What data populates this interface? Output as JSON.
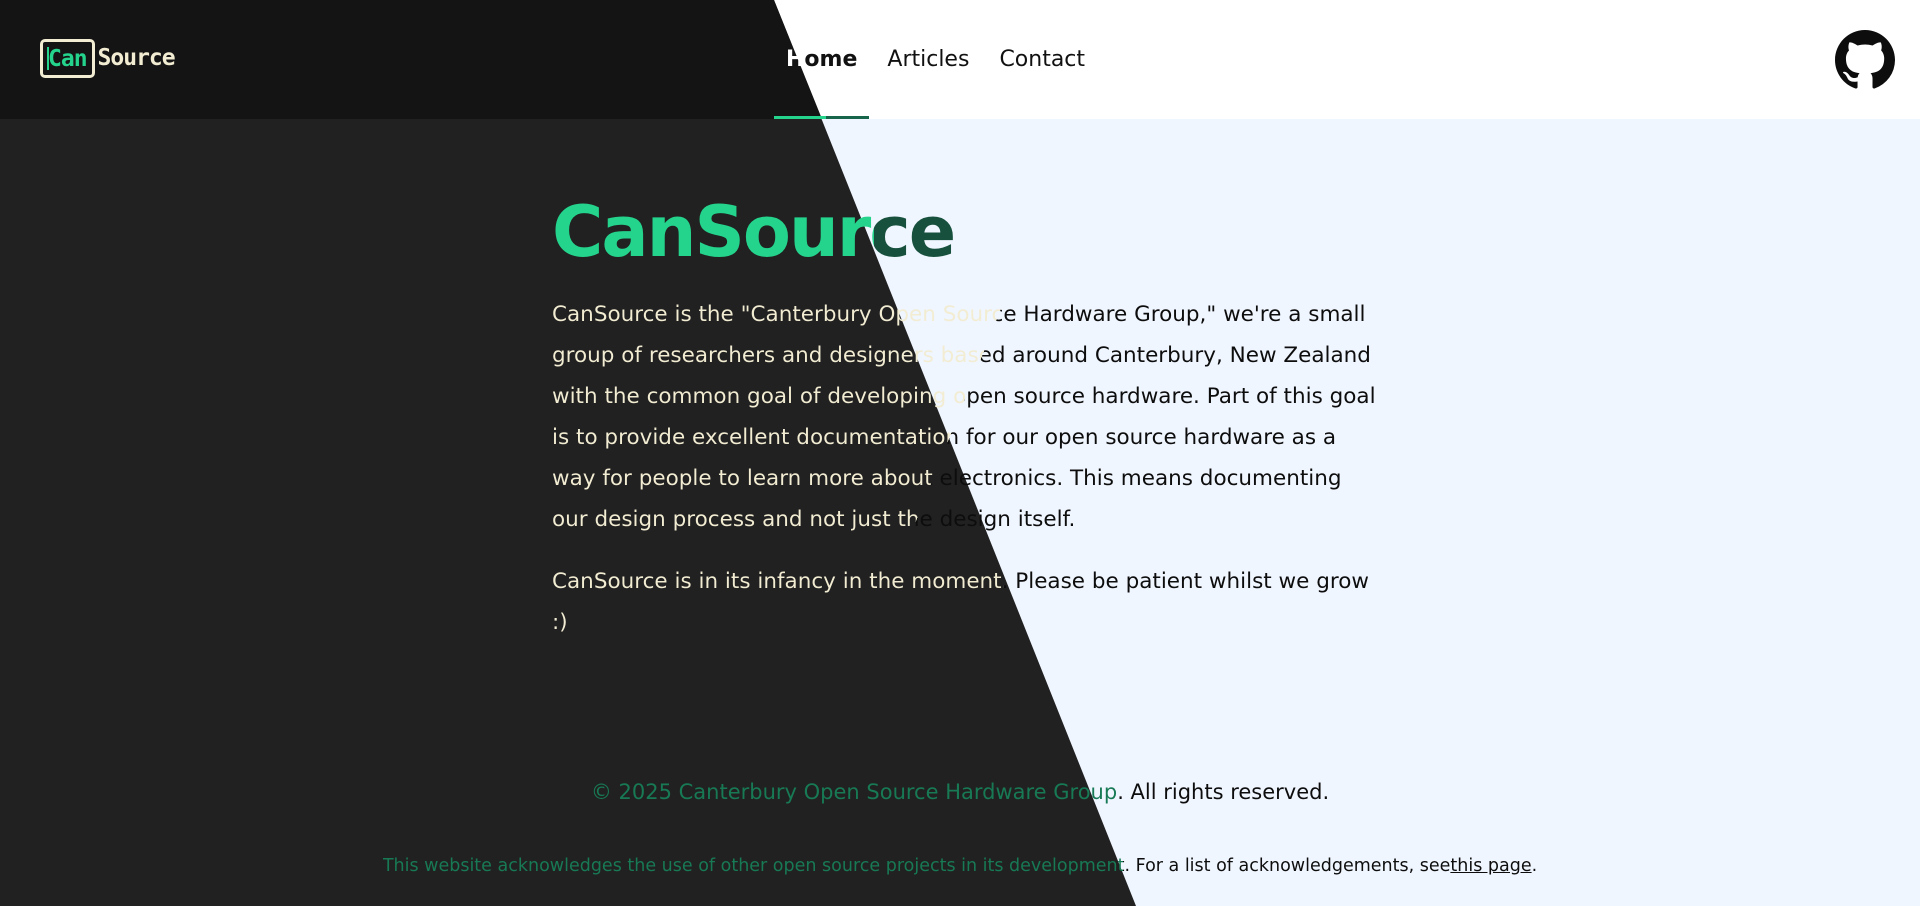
{
  "header": {
    "logo": {
      "box_text": "Can",
      "text": "Source"
    },
    "nav": [
      {
        "label": "Home",
        "active": true
      },
      {
        "label": "Articles",
        "active": false
      },
      {
        "label": "Contact",
        "active": false
      }
    ],
    "github_icon": "github-icon"
  },
  "main": {
    "title": "CanSource",
    "paragraphs": [
      "CanSource is the \"Canterbury Open Source Hardware Group,\" we're a small group of researchers and designers based around Canterbury, New Zealand with the common goal of developing open source hardware. Part of this goal is to provide excellent documentation for our open source hardware as a way for people to learn more about electronics. This means documenting our design process and not just the design itself.",
      "CanSource is in its infancy in the moment. Please be patient whilst we grow :)"
    ]
  },
  "footer": {
    "copyright": "© 2025 Canterbury Open Source Hardware Group. All rights reserved.",
    "ack_text": "This website acknowledges the use of other open source projects in its development. For a list of acknowledgements, see ",
    "ack_link": "this page",
    "ack_end": "."
  },
  "colors": {
    "accent": "#24d48c",
    "dark_bg": "#212121",
    "header_dark": "#141414",
    "light_bg": "#f0f6ff",
    "cream": "#f2ecd2"
  }
}
